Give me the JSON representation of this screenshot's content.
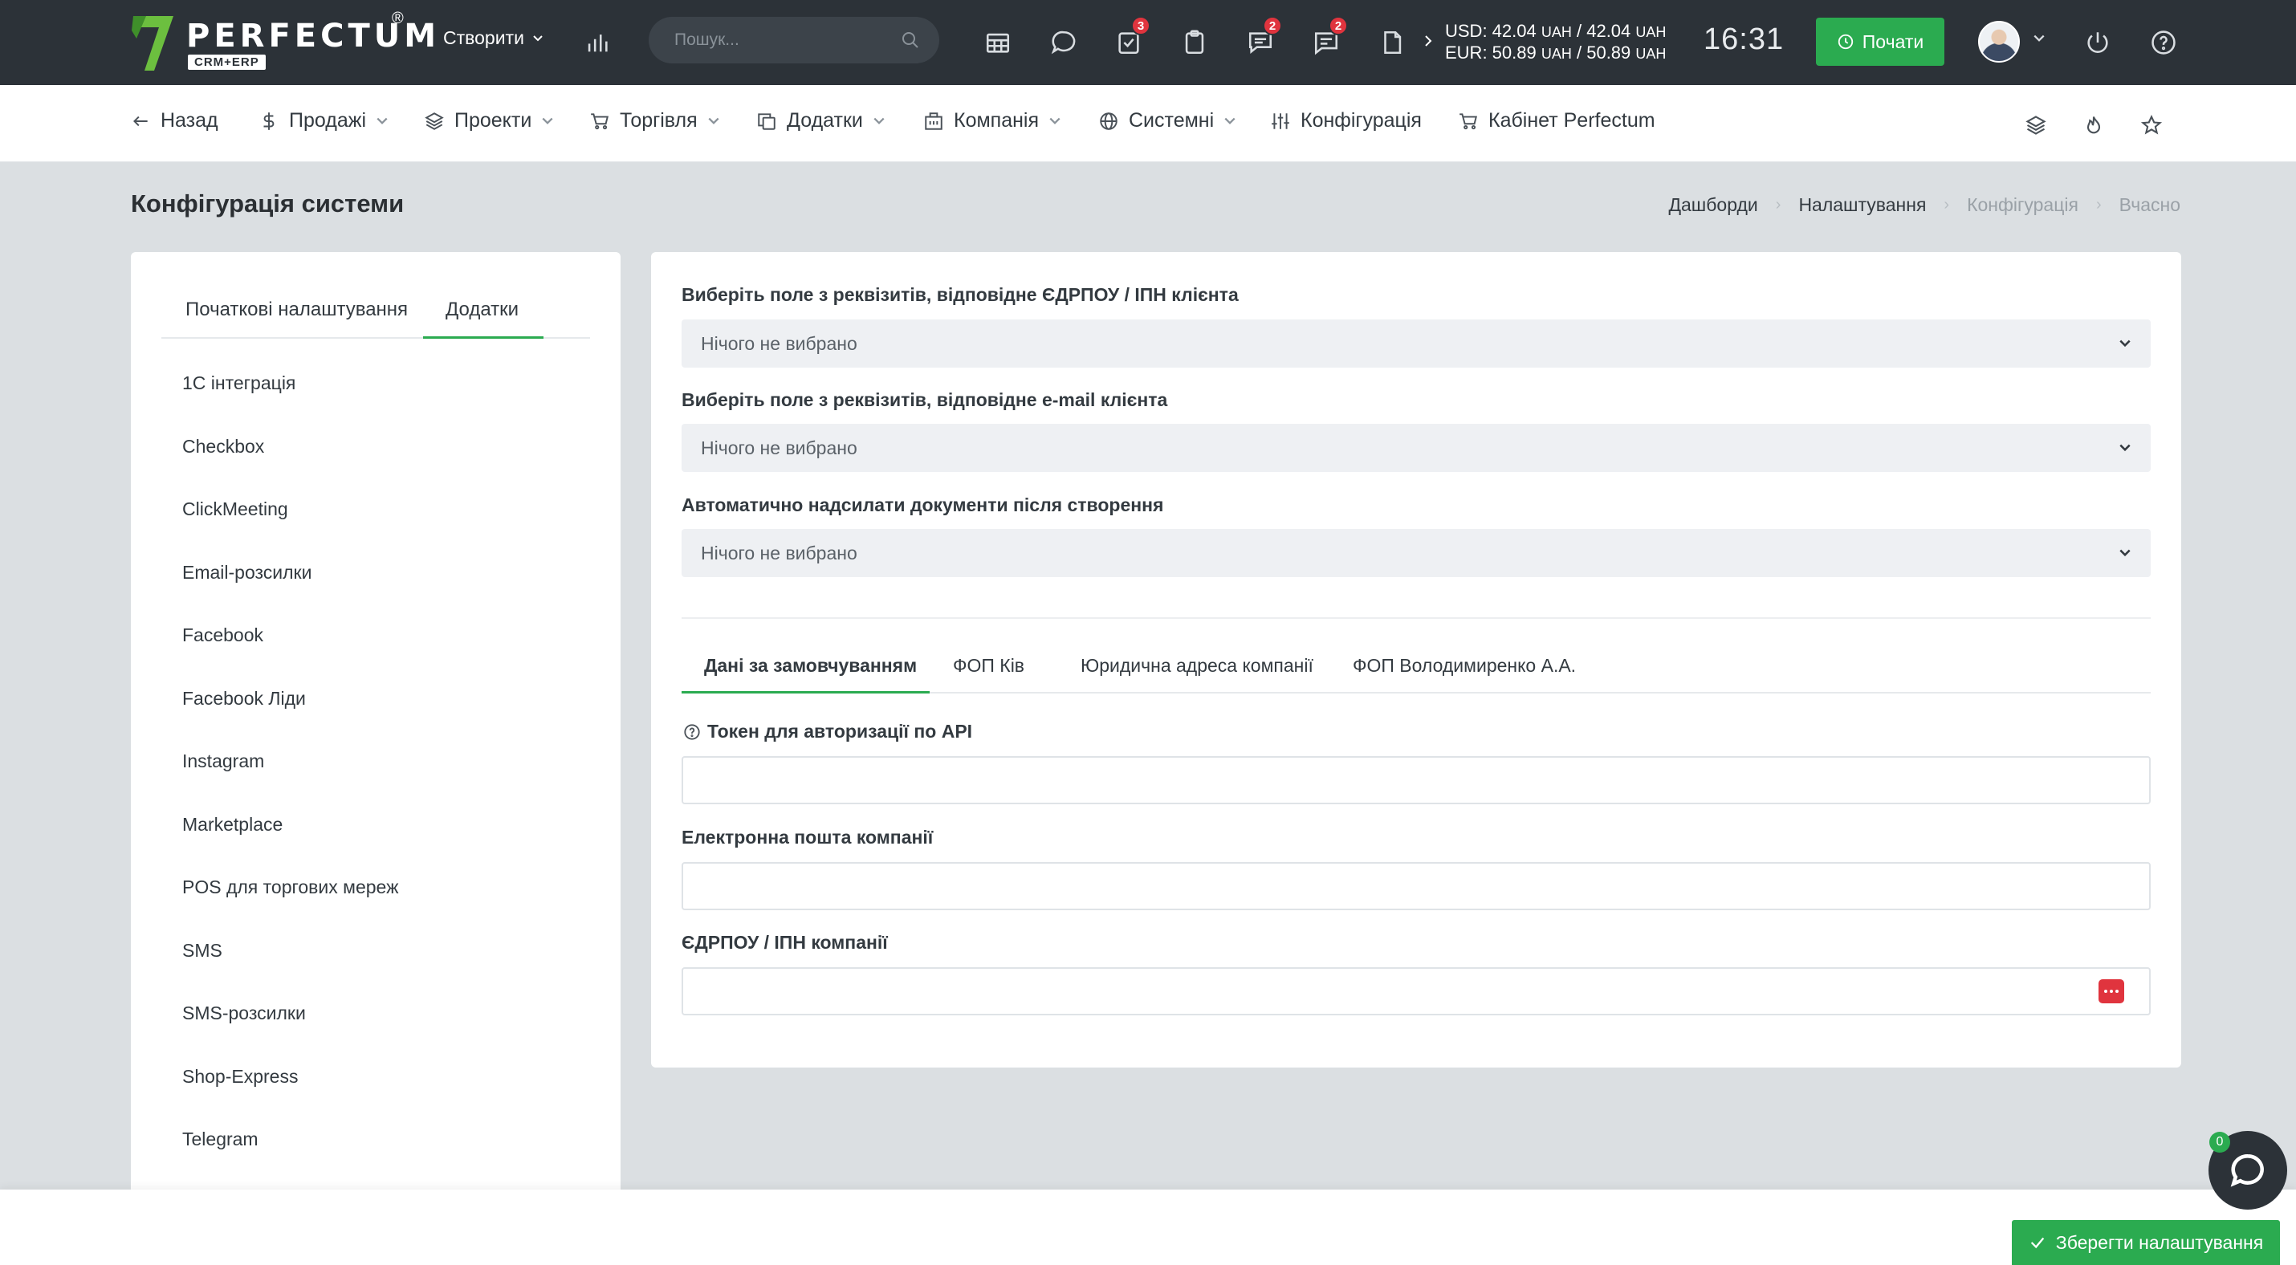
{
  "header": {
    "logo_text": "PERFECTUM",
    "logo_sub": "CRM+ERP",
    "logo_reg": "®",
    "create_label": "Створити",
    "search_placeholder": "Пошук...",
    "badges": {
      "tasks": "3",
      "chat": "2",
      "messages": "2"
    },
    "rates": {
      "usd_label": "USD: 42.04",
      "usd_mid": "/ 42.04",
      "eur_label": "EUR: 50.89",
      "eur_mid": "/ 50.89",
      "currency": "UAH"
    },
    "time": "16:31",
    "start_label": "Почати"
  },
  "nav": {
    "back": "Назад",
    "sales": "Продажі",
    "projects": "Проекти",
    "trade": "Торгівля",
    "addons": "Додатки",
    "company": "Компанія",
    "system": "Системні",
    "config": "Конфігурація",
    "cabinet": "Кабінет Perfectum"
  },
  "page": {
    "title": "Конфігурація системи",
    "breadcrumb": [
      "Дашборди",
      "Налаштування",
      "Конфігурація",
      "Вчасно"
    ]
  },
  "left": {
    "tabs": [
      "Початкові налаштування",
      "Додатки"
    ],
    "active_tab": "Додатки",
    "items": [
      "1С інтеграція",
      "Checkbox",
      "ClickMeeting",
      "Email-розсилки",
      "Facebook",
      "Facebook Ліди",
      "Instagram",
      "Marketplace",
      "POS для торгових мереж",
      "SMS",
      "SMS-розсилки",
      "Shop-Express",
      "Telegram"
    ]
  },
  "form": {
    "field1_label": "Виберіть поле з реквізитів, відповідне ЄДРПОУ / ІПН клієнта",
    "field1_value": "Нічого не вибрано",
    "field2_label": "Виберіть поле з реквізитів, відповідне e-mail клієнта",
    "field2_value": "Нічого не вибрано",
    "field3_label": "Автоматично надсилати документи після створення",
    "field3_value": "Нічого не вибрано",
    "tabs": [
      "Дані за замовчуванням",
      "ФОП Ків",
      "Юридична адреса компанії",
      "ФОП Володимиренко А.А."
    ],
    "active_tab": "Дані за замовчуванням",
    "token_label": "Токен для авторизації по API",
    "token_value": "",
    "email_label": "Електронна пошта компанії",
    "email_value": "",
    "edrpou_label": "ЄДРПОУ / ІПН компанії",
    "edrpou_value": ""
  },
  "footer": {
    "save_label": "Зберегти налаштування"
  },
  "chat": {
    "count": "0"
  },
  "colors": {
    "accent": "#2bab50",
    "topbar": "#2c3238",
    "badge": "#e0343e",
    "background": "#dbdfe2"
  }
}
